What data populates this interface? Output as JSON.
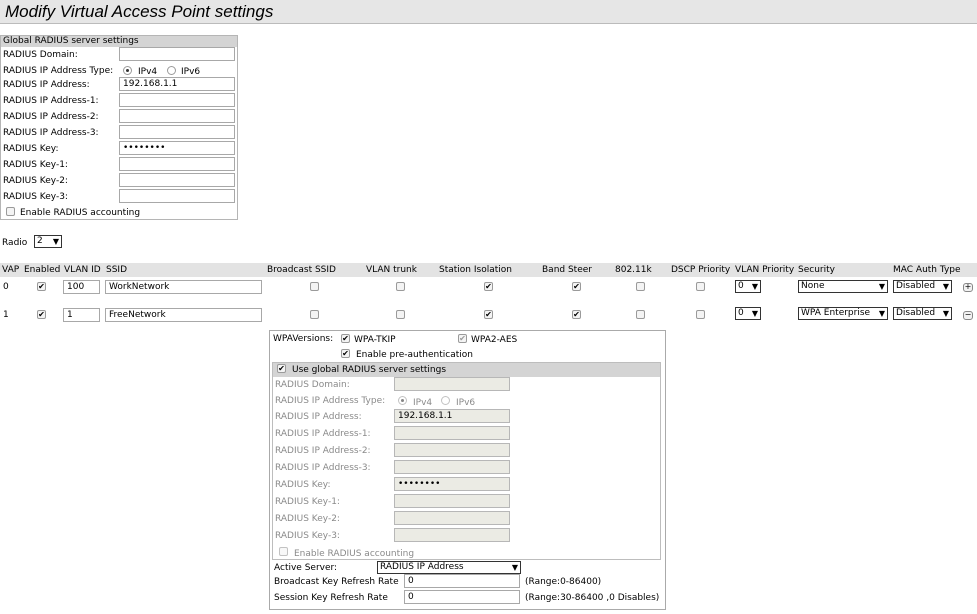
{
  "page_title": "Modify Virtual Access Point settings",
  "global_radius": {
    "header": "Global RADIUS server settings",
    "domain_label": "RADIUS Domain:",
    "domain_value": "",
    "ip_type_label": "RADIUS IP Address Type:",
    "ipv4_label": "IPv4",
    "ipv6_label": "IPv6",
    "ip_label": "RADIUS IP Address:",
    "ip_value": "192.168.1.1",
    "ip1_label": "RADIUS IP Address-1:",
    "ip2_label": "RADIUS IP Address-2:",
    "ip3_label": "RADIUS IP Address-3:",
    "key_label": "RADIUS Key:",
    "key_value": "••••••••",
    "key1_label": "RADIUS Key-1:",
    "key2_label": "RADIUS Key-2:",
    "key3_label": "RADIUS Key-3:",
    "accounting_label": "Enable RADIUS accounting"
  },
  "radio": {
    "label": "Radio",
    "value": "2"
  },
  "table": {
    "headers": {
      "vap": "VAP",
      "enabled": "Enabled",
      "vlan_id": "VLAN ID",
      "ssid": "SSID",
      "broadcast": "Broadcast SSID",
      "trunk": "VLAN trunk",
      "isolation": "Station Isolation",
      "band": "Band Steer",
      "dot11k": "802.11k",
      "dscp": "DSCP Priority",
      "vlan_priority": "VLAN Priority",
      "security": "Security",
      "mac_auth": "MAC Auth Type"
    },
    "rows": [
      {
        "vap": "0",
        "vlan_id": "100",
        "ssid": "WorkNetwork",
        "vlan_priority": "0",
        "security": "None",
        "mac_auth": "Disabled",
        "action": "+"
      },
      {
        "vap": "1",
        "vlan_id": "1",
        "ssid": "FreeNetwork",
        "vlan_priority": "0",
        "security": "WPA Enterprise",
        "mac_auth": "Disabled",
        "action": "−"
      }
    ]
  },
  "wpa": {
    "versions_label": "WPAVersions:",
    "tkip_label": "WPA-TKIP",
    "aes_label": "WPA2-AES",
    "preauth_label": "Enable pre-authentication",
    "use_global_label": "Use global RADIUS server settings",
    "domain_label": "RADIUS Domain:",
    "ip_type_label": "RADIUS IP Address Type:",
    "ipv4_label": "IPv4",
    "ipv6_label": "IPv6",
    "ip_label": "RADIUS IP Address:",
    "ip_value": "192.168.1.1",
    "ip1_label": "RADIUS IP Address-1:",
    "ip2_label": "RADIUS IP Address-2:",
    "ip3_label": "RADIUS IP Address-3:",
    "key_label": "RADIUS Key:",
    "key_value": "••••••••",
    "key1_label": "RADIUS Key-1:",
    "key2_label": "RADIUS Key-2:",
    "key3_label": "RADIUS Key-3:",
    "accounting_label": "Enable RADIUS accounting",
    "active_server_label": "Active Server:",
    "active_server_value": "RADIUS IP Address",
    "broadcast_refresh_label": "Broadcast Key Refresh Rate",
    "broadcast_refresh_value": "0",
    "broadcast_refresh_range": "(Range:0-86400)",
    "session_refresh_label": "Session Key Refresh Rate",
    "session_refresh_value": "0",
    "session_refresh_range": "(Range:30-86400 ,0 Disables)"
  },
  "icons": {
    "dropdown": "▼",
    "check": "✔"
  }
}
